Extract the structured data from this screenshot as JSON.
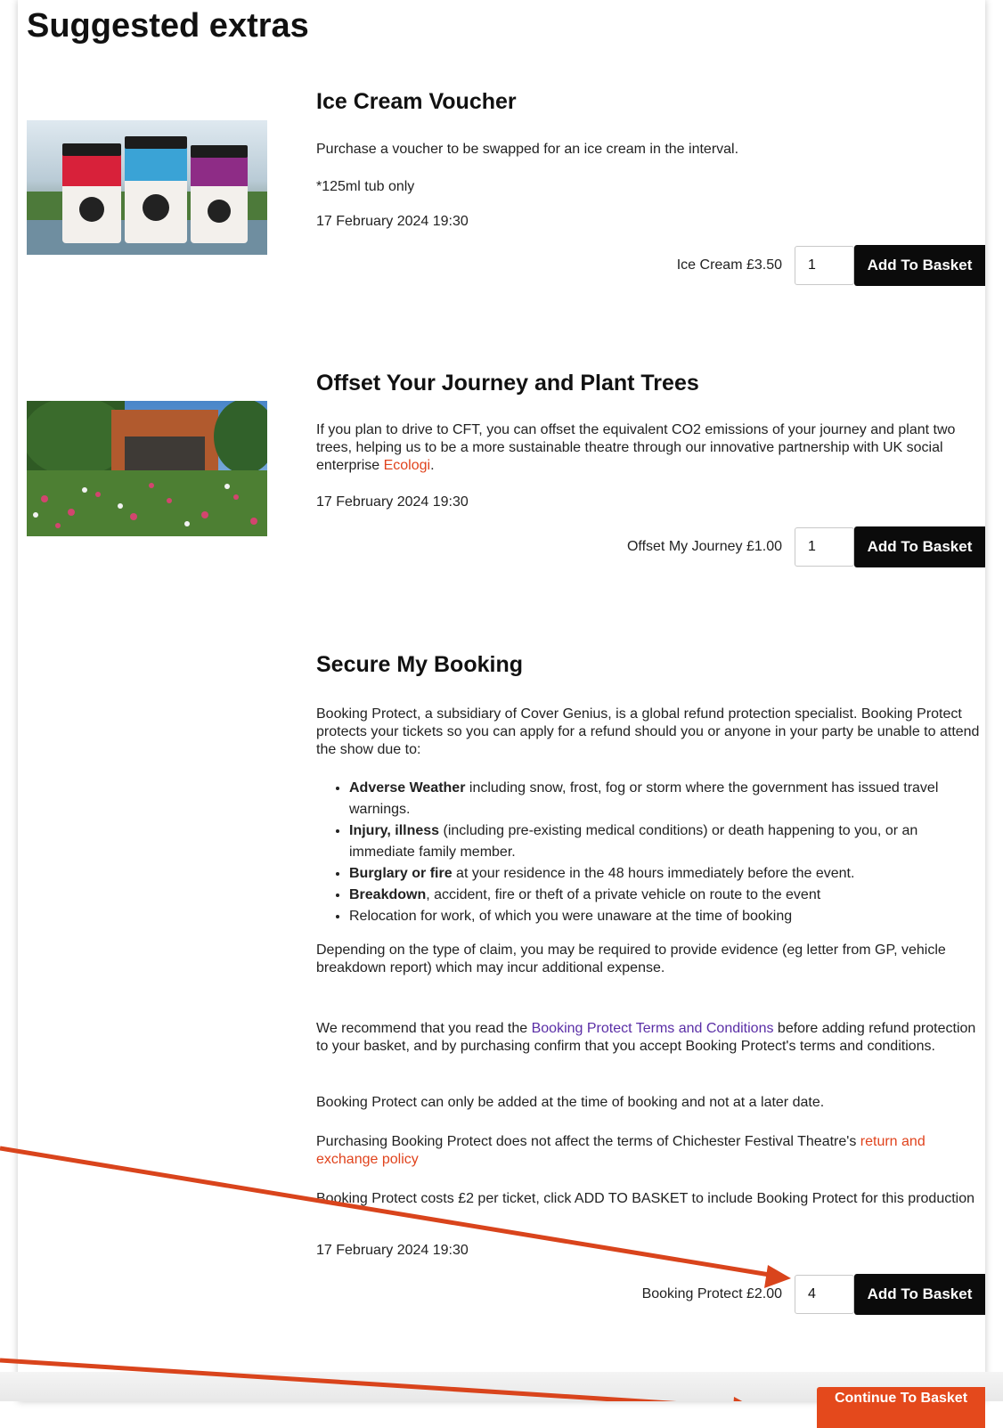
{
  "page": {
    "title": "Suggested extras"
  },
  "colors": {
    "accent_orange": "#e4491c",
    "link_orange": "#e0431d",
    "link_purple": "#5a2ea6",
    "button_dark": "#0b0b0b",
    "annotation_arrow": "#d9441c"
  },
  "items": {
    "ice_cream": {
      "title": "Ice Cream Voucher",
      "description": "Purchase a voucher to be swapped for an ice cream in the interval.",
      "note": "*125ml tub only",
      "date": "17 February 2024 19:30",
      "price_label": "Ice Cream £3.50",
      "quantity": "1",
      "button_label": "Add To Basket",
      "image_icon": "ice-cream-tubs-image"
    },
    "offset": {
      "title": "Offset Your Journey and Plant Trees",
      "description_pre": "If you plan to drive to CFT, you can offset the equivalent CO2 emissions of your journey and plant two trees, helping us to be a more sustainable theatre through our innovative partnership with UK social enterprise ",
      "description_link": "Ecologi",
      "description_post": ".",
      "date": "17 February 2024 19:30",
      "price_label": "Offset My Journey £1.00",
      "quantity": "1",
      "button_label": "Add To Basket",
      "image_icon": "wildflower-meadow-image"
    },
    "secure": {
      "title": "Secure My Booking",
      "intro": "Booking Protect, a subsidiary of Cover Genius, is a global refund protection specialist. Booking Protect protects your tickets so you can apply for a refund should you or anyone in your party be unable to attend the show due to:",
      "reasons": [
        {
          "bold": "Adverse Weather",
          "rest": " including snow, frost, fog or storm where the government has issued travel warnings."
        },
        {
          "bold": "Injury, illness",
          "rest": " (including pre-existing medical conditions) or death happening to you, or an immediate family member."
        },
        {
          "bold": "Burglary or fire",
          "rest": " at your residence in the 48 hours immediately before the event."
        },
        {
          "bold": "Breakdown",
          "rest": ", accident, fire or theft of a private vehicle on route to the event"
        },
        {
          "bold": "",
          "rest": "Relocation for work, of which you were unaware at the time of booking"
        }
      ],
      "evidence": "Depending on the type of claim, you may be required to provide evidence (eg letter from GP, vehicle breakdown report) which may incur additional expense.",
      "recommend_pre": "We recommend that you read the ",
      "recommend_link": "Booking Protect Terms and Conditions",
      "recommend_post": " before adding refund protection to your basket, and by purchasing confirm that you accept Booking Protect's terms and conditions.",
      "only_at_booking": "Booking Protect can only be added at the time of booking and not at a later date.",
      "policy_pre": "Purchasing Booking Protect does not affect the terms of Chichester Festival Theatre's ",
      "policy_link": "return and exchange policy",
      "cost_text": "Booking Protect costs £2 per ticket, click ADD TO BASKET to include Booking Protect for this production",
      "date": "17 February 2024 19:30",
      "price_label": "Booking Protect £2.00",
      "quantity": "4",
      "button_label": "Add To Basket"
    }
  },
  "footer": {
    "continue_label": "Continue To Basket"
  }
}
